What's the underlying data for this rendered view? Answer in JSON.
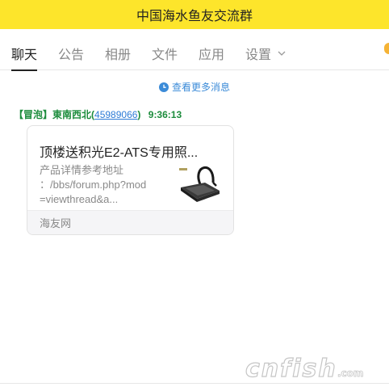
{
  "window": {
    "title": "中国海水鱼友交流群",
    "accent_color": "#fde52b"
  },
  "tabs": [
    {
      "label": "聊天",
      "active": true
    },
    {
      "label": "公告"
    },
    {
      "label": "相册"
    },
    {
      "label": "文件"
    },
    {
      "label": "应用"
    },
    {
      "label": "设置",
      "icon": "chevron-down-icon"
    }
  ],
  "history": {
    "label": "查看更多消息",
    "icon": "clock-icon"
  },
  "message": {
    "badge": "【冒泡】",
    "sender": "東南西北",
    "qq_open": "(",
    "qq": "45989066",
    "qq_close": ")",
    "time": "9:36:13",
    "card": {
      "title": "顶楼送积光E2-ATS专用照...",
      "desc_lines": [
        "产品详情参考地址",
        "：/bbs/forum.php?mod",
        "=viewthread&a..."
      ],
      "source": "海友网",
      "thumb_icon": "aquarium-light-icon"
    }
  },
  "watermark": {
    "text": "cnfish",
    "suffix": ".com"
  }
}
